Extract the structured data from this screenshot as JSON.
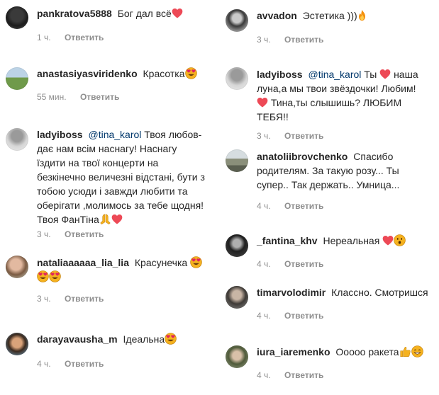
{
  "colors": {
    "username": "#262626",
    "meta": "#8e8e8e",
    "mention": "#00376b",
    "heart": "#ed4956"
  },
  "reply_label": "Ответить",
  "left": [
    {
      "user": "pankratova5888",
      "text": "Бог дал всё",
      "time": "1 ч."
    },
    {
      "user": "anastasiyasviridenko",
      "text": "Красотка",
      "time": "55 мин."
    },
    {
      "user": "ladyiboss",
      "mention": "@tina_karol",
      "text": "Твоя любов- дає нам всім наснагу! Наснагу їздити на твої концерти на безкінечно величезні відстані, бути з тобою усюди і завжди любити та оберігати ,молимось за тебе щодня! Твоя ФанТіна",
      "time": "3 ч."
    },
    {
      "user": "nataliaaaaaa_lia_lia",
      "text": "Красунечка",
      "time": "3 ч."
    },
    {
      "user": "darayavausha_m",
      "text": "Ідеальна",
      "time": "4 ч."
    }
  ],
  "right": [
    {
      "user": "avvadon",
      "text": "Эстетика )))",
      "time": "3 ч."
    },
    {
      "user": "ladyiboss",
      "mention": "@tina_karol",
      "text1": "Ты",
      "text2": "наша луна,а мы твои звёздочки! Любим!",
      "text3": "Тина,ты слышишь? ЛЮБИМ ТЕБЯ!!",
      "time": "3 ч."
    },
    {
      "user": "anatoliibrovchenko",
      "text": "Спасибо родителям. За такую розу... Ты супер.. Так держать.. Умница...",
      "time": "4 ч."
    },
    {
      "user": "_fantina_khv",
      "text": "Нереальная",
      "time": "4 ч."
    },
    {
      "user": "timarvolodimir",
      "text": "Классно. Смотришся",
      "time": "4 ч."
    },
    {
      "user": "iura_iaremenko",
      "text": "Ооооо ракета",
      "time": "4 ч."
    }
  ]
}
